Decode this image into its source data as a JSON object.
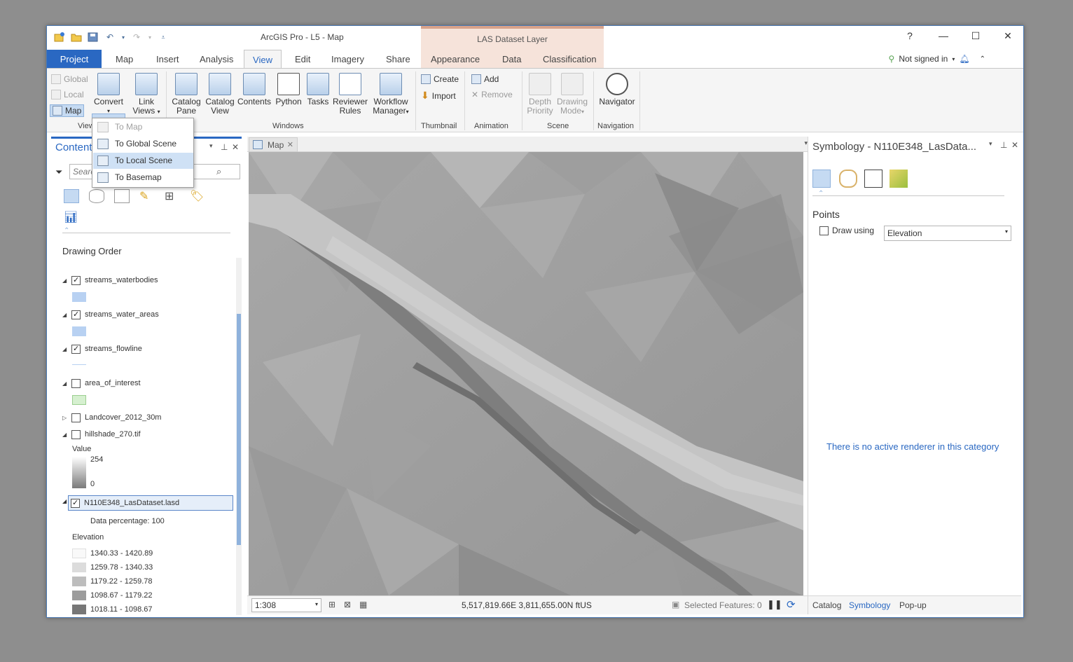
{
  "app": {
    "title": "ArcGIS Pro - L5 - Map",
    "contextual_tab_title": "LAS Dataset Layer",
    "sign_in": "Not signed in"
  },
  "tabs": [
    "Project",
    "Map",
    "Insert",
    "Analysis",
    "View",
    "Edit",
    "Imagery",
    "Share",
    "Appearance",
    "Data",
    "Classification"
  ],
  "active_tab": "View",
  "ribbon": {
    "view_small": [
      "Global",
      "Local",
      "Map"
    ],
    "convert": "Convert",
    "link_views": [
      "Link",
      "Views"
    ],
    "catalog_pane": [
      "Catalog",
      "Pane"
    ],
    "catalog_view": [
      "Catalog",
      "View"
    ],
    "contents": "Contents",
    "python": "Python",
    "tasks": "Tasks",
    "reviewer_rules": [
      "Reviewer",
      "Rules"
    ],
    "workflow_manager": [
      "Workflow",
      "Manager"
    ],
    "thumbnail_create": "Create",
    "thumbnail_import": "Import",
    "animation_add": "Add",
    "animation_remove": "Remove",
    "depth_priority": [
      "Depth",
      "Priority"
    ],
    "drawing_mode": [
      "Drawing",
      "Mode"
    ],
    "navigator": "Navigator",
    "group_labels": {
      "view": "View",
      "windows": "Windows",
      "thumbnail": "Thumbnail",
      "animation": "Animation",
      "scene": "Scene",
      "navigation": "Navigation"
    }
  },
  "convert_menu": {
    "items": [
      {
        "label": "To Map",
        "disabled": true
      },
      {
        "label": "To Global Scene",
        "disabled": false
      },
      {
        "label": "To Local Scene",
        "disabled": false,
        "hover": true
      },
      {
        "label": "To Basemap",
        "disabled": false
      }
    ]
  },
  "contents_pane": {
    "title": "Contents",
    "search_placeholder": "Search",
    "drawing_order": "Drawing Order",
    "layers": [
      {
        "name": "streams_waterbodies",
        "checked": true,
        "expanded": true,
        "swatch": "#b8d1f2"
      },
      {
        "name": "streams_water_areas",
        "checked": true,
        "expanded": true,
        "swatch": "#b8d1f2"
      },
      {
        "name": "streams_flowline",
        "checked": true,
        "expanded": true,
        "swatch": "line"
      },
      {
        "name": "area_of_interest",
        "checked": false,
        "expanded": true,
        "swatch": "#d6f0d0"
      },
      {
        "name": "Landcover_2012_30m",
        "checked": false,
        "expanded": false
      },
      {
        "name": "hillshade_270.tif",
        "checked": false,
        "expanded": true
      },
      {
        "name": "N110E348_LasDataset.lasd",
        "checked": true,
        "expanded": true,
        "selected": true
      }
    ],
    "hillshade_legend": {
      "label": "Value",
      "high": "254",
      "low": "0"
    },
    "las_info": "Data percentage: 100",
    "elevation_label": "Elevation",
    "elevation_classes": [
      {
        "range": "1340.33 - 1420.89",
        "color": "#f9f9f9"
      },
      {
        "range": "1259.78 - 1340.33",
        "color": "#dcdcdc"
      },
      {
        "range": "1179.22 - 1259.78",
        "color": "#bdbdbd"
      },
      {
        "range": "1098.67 - 1179.22",
        "color": "#9c9c9c"
      },
      {
        "range": "1018.11 - 1098.67",
        "color": "#777777"
      }
    ]
  },
  "map_view": {
    "tab_label": "Map",
    "scale": "1:308",
    "coordinates": "5,517,819.66E 3,811,655.00N ftUS",
    "selected_features": "Selected Features: 0"
  },
  "symbology_pane": {
    "title": "Symbology - N110E348_LasData...",
    "section": "Points",
    "draw_using_label": "Draw using",
    "draw_using_value": "Elevation",
    "empty_message": "There is no active renderer in this category",
    "bottom_tabs": [
      "Catalog",
      "Symbology",
      "Pop-up"
    ],
    "active_bottom_tab": "Symbology"
  },
  "colors": {
    "accent": "#2a68c2",
    "contextual": "#f6e3da",
    "selection": "#cfe1f5"
  }
}
